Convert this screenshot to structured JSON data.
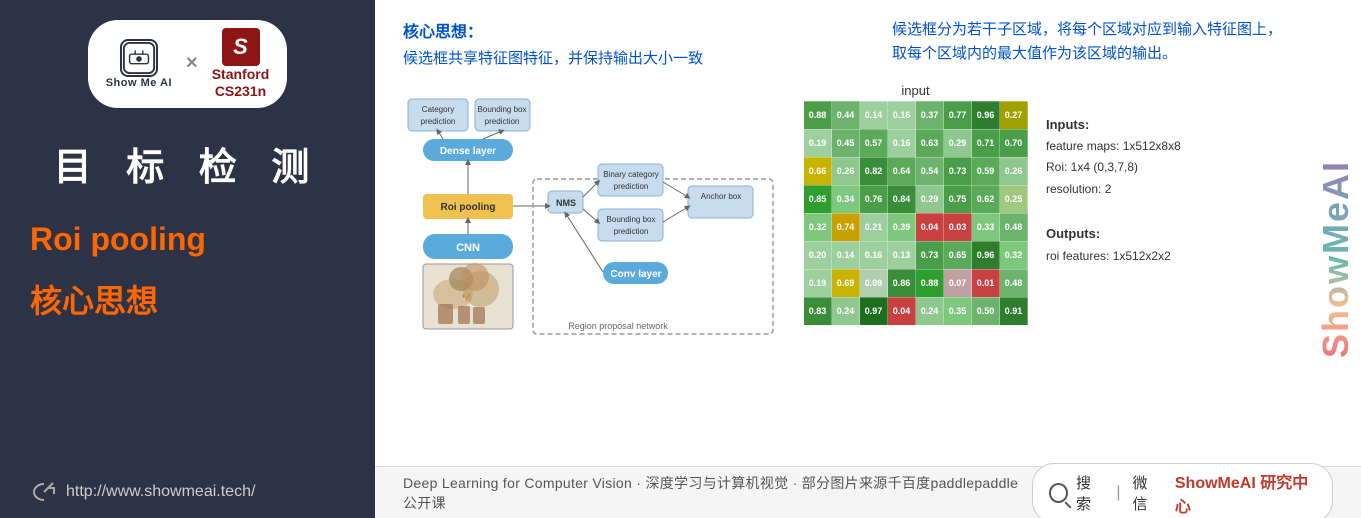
{
  "sidebar": {
    "logo": {
      "showmeai_text": "Show Me AI",
      "x": "×",
      "stanford_s": "S",
      "stanford_line1": "Stanford",
      "stanford_line2": "CS231n"
    },
    "title": "目 标 检 测",
    "roi_label": "Roi pooling",
    "core_label": "核心思想",
    "footer_url": "http://www.showmeai.tech/"
  },
  "top_left": {
    "heading": "核心思想：",
    "body": "候选框共享特征图特征，并保持输出大小一致"
  },
  "top_right": {
    "body": "候选框分为若干子区域，将每个区域对应到输入特征图上，\n取每个区域内的最大值作为该区域的输出。"
  },
  "watermark": "ShowMeAI",
  "grid": {
    "label": "input",
    "cells": [
      [
        {
          "v": "0.88",
          "c": "#4a9e4a"
        },
        {
          "v": "0.44",
          "c": "#6db36d"
        },
        {
          "v": "0.14",
          "c": "#9ecf9e"
        },
        {
          "v": "0.16",
          "c": "#9ecf9e"
        },
        {
          "v": "0.37",
          "c": "#6db36d"
        },
        {
          "v": "0.77",
          "c": "#4a9e4a"
        },
        {
          "v": "0.96",
          "c": "#2e7e2e"
        },
        {
          "v": "0.27",
          "c": "#a0a000"
        }
      ],
      [
        {
          "v": "0.19",
          "c": "#9ecf9e"
        },
        {
          "v": "0.45",
          "c": "#6db36d"
        },
        {
          "v": "0.57",
          "c": "#5aaa5a"
        },
        {
          "v": "0.16",
          "c": "#9ecf9e"
        },
        {
          "v": "0.63",
          "c": "#5aaa5a"
        },
        {
          "v": "0.29",
          "c": "#8ec88e"
        },
        {
          "v": "0.71",
          "c": "#4a9e4a"
        },
        {
          "v": "0.70",
          "c": "#4a9e4a"
        }
      ],
      [
        {
          "v": "0.66",
          "c": "#c8b400"
        },
        {
          "v": "0.26",
          "c": "#8ec88e"
        },
        {
          "v": "0.82",
          "c": "#3a8e3a"
        },
        {
          "v": "0.64",
          "c": "#5aaa5a"
        },
        {
          "v": "0.54",
          "c": "#6db36d"
        },
        {
          "v": "0.73",
          "c": "#4a9e4a"
        },
        {
          "v": "0.59",
          "c": "#5aaa5a"
        },
        {
          "v": "0.26",
          "c": "#8ec88e"
        }
      ],
      [
        {
          "v": "0.85",
          "c": "#2e9e2e"
        },
        {
          "v": "0.34",
          "c": "#7ec87e"
        },
        {
          "v": "0.76",
          "c": "#4a9e4a"
        },
        {
          "v": "0.84",
          "c": "#3a8e3a"
        },
        {
          "v": "0.29",
          "c": "#8ec88e"
        },
        {
          "v": "0.75",
          "c": "#4a9e4a"
        },
        {
          "v": "0.62",
          "c": "#5aaa5a"
        },
        {
          "v": "0.25",
          "c": "#a0c87e"
        }
      ],
      [
        {
          "v": "0.32",
          "c": "#7ec87e"
        },
        {
          "v": "0.74",
          "c": "#c8a000"
        },
        {
          "v": "0.21",
          "c": "#9ecf9e"
        },
        {
          "v": "0.39",
          "c": "#7ec87e"
        },
        {
          "v": "0.04",
          "c": "#c84040"
        },
        {
          "v": "0.03",
          "c": "#c84040"
        },
        {
          "v": "0.33",
          "c": "#7ec87e"
        },
        {
          "v": "0.48",
          "c": "#6db36d"
        }
      ],
      [
        {
          "v": "0.20",
          "c": "#9ecf9e"
        },
        {
          "v": "0.14",
          "c": "#9ecf9e"
        },
        {
          "v": "0.16",
          "c": "#9ecf9e"
        },
        {
          "v": "0.13",
          "c": "#9ecf9e"
        },
        {
          "v": "0.73",
          "c": "#4a9e4a"
        },
        {
          "v": "0.65",
          "c": "#5aaa5a"
        },
        {
          "v": "0.96",
          "c": "#2e7e2e"
        },
        {
          "v": "0.32",
          "c": "#7ec87e"
        }
      ],
      [
        {
          "v": "0.19",
          "c": "#9ecf9e"
        },
        {
          "v": "0.69",
          "c": "#c8b400"
        },
        {
          "v": "0.09",
          "c": "#b0cfb0"
        },
        {
          "v": "0.86",
          "c": "#3a8e3a"
        },
        {
          "v": "0.88",
          "c": "#2e9e2e"
        },
        {
          "v": "0.07",
          "c": "#c0a0a0"
        },
        {
          "v": "0.01",
          "c": "#c84040"
        },
        {
          "v": "0.48",
          "c": "#6db36d"
        }
      ],
      [
        {
          "v": "0.83",
          "c": "#3a8e3a"
        },
        {
          "v": "0.24",
          "c": "#8ec88e"
        },
        {
          "v": "0.97",
          "c": "#1e6e1e"
        },
        {
          "v": "0.04",
          "c": "#c84040"
        },
        {
          "v": "0.24",
          "c": "#8ec88e"
        },
        {
          "v": "0.35",
          "c": "#7ec87e"
        },
        {
          "v": "0.50",
          "c": "#6db36d"
        },
        {
          "v": "0.91",
          "c": "#2e7e2e"
        }
      ]
    ]
  },
  "info_panel": {
    "inputs_label": "Inputs:",
    "input_line1": "feature maps: 1x512x8x8",
    "input_line2": "Roi: 1x4 (0,3,7,8)",
    "input_line3": "resolution: 2",
    "outputs_label": "Outputs:",
    "output_line1": "roi features: 1x512x2x2"
  },
  "bottom": {
    "text": "Deep Learning for Computer Vision · 深度学习与计算机视觉 · 部分图片来源千百度paddlepaddle公开课",
    "search_label": "搜索",
    "divider": "|",
    "wechat_label": "微信",
    "brand": "ShowMeAI 研究中心"
  }
}
